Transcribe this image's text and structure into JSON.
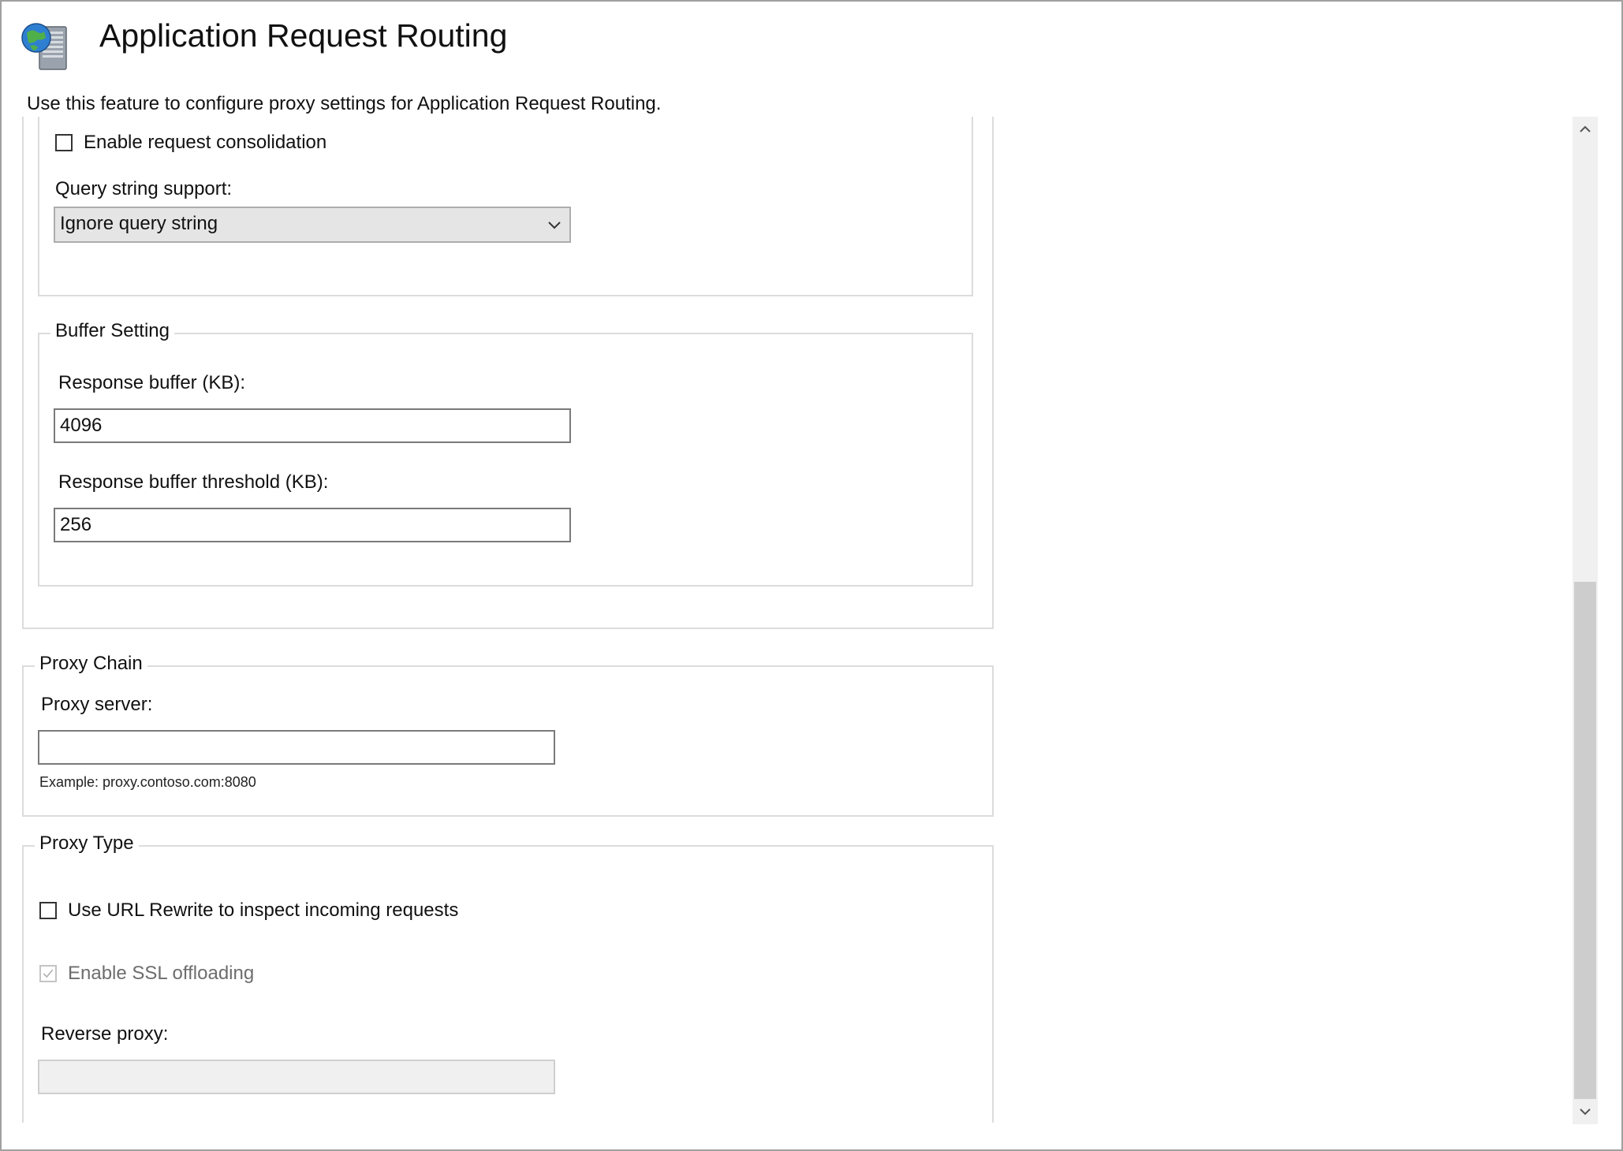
{
  "header": {
    "title": "Application Request Routing",
    "description": "Use this feature to configure proxy settings for Application Request Routing."
  },
  "request_consolidation": {
    "checkbox_label": "Enable request consolidation",
    "checked": false,
    "query_string_label": "Query string support:",
    "query_string_value": "Ignore query string"
  },
  "buffer_setting": {
    "legend": "Buffer Setting",
    "response_buffer_label": "Response buffer (KB):",
    "response_buffer_value": "4096",
    "response_buffer_threshold_label": "Response buffer threshold (KB):",
    "response_buffer_threshold_value": "256"
  },
  "proxy_chain": {
    "legend": "Proxy Chain",
    "proxy_server_label": "Proxy server:",
    "proxy_server_value": "",
    "example_note": "Example: proxy.contoso.com:8080"
  },
  "proxy_type": {
    "legend": "Proxy Type",
    "url_rewrite_label": "Use URL Rewrite to inspect incoming requests",
    "url_rewrite_checked": false,
    "ssl_offloading_label": "Enable SSL offloading",
    "ssl_offloading_checked": true,
    "ssl_offloading_enabled": false,
    "reverse_proxy_label": "Reverse proxy:",
    "reverse_proxy_value": ""
  },
  "icons": {
    "app": "globe-server-icon",
    "dropdown": "chevron-down-icon",
    "scroll_up": "chevron-up-icon",
    "scroll_down": "chevron-down-icon"
  }
}
